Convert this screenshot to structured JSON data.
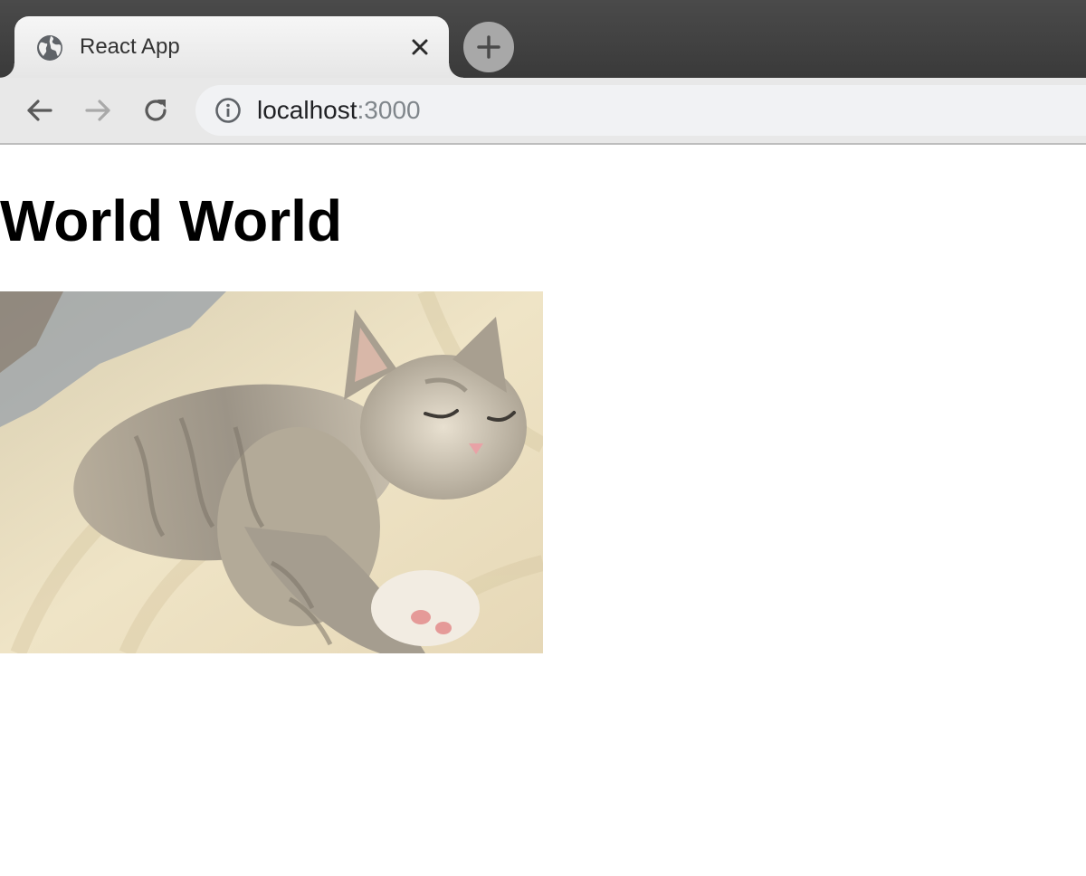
{
  "browser": {
    "tab": {
      "title": "React App",
      "favicon_icon": "globe-icon",
      "close_icon": "close-icon"
    },
    "new_tab_icon": "plus-icon",
    "toolbar": {
      "back_icon": "arrow-left-icon",
      "forward_icon": "arrow-right-icon",
      "reload_icon": "reload-icon",
      "info_icon": "info-icon"
    },
    "address": {
      "host": "localhost",
      "port": ":3000"
    }
  },
  "page": {
    "heading": "World World",
    "image": {
      "subject": "sleeping tabby kitten on striped blanket"
    }
  },
  "colors": {
    "tabstrip": "#3d3d3d",
    "toolbar": "#e8e8e8",
    "omnibox": "#f1f2f4",
    "url_host": "#202124",
    "url_port": "#80868b"
  }
}
